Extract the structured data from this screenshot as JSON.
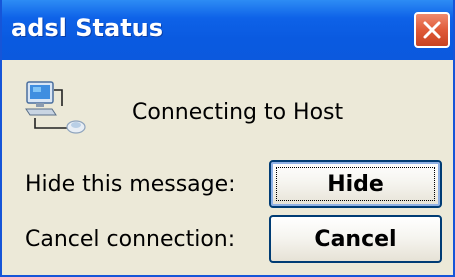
{
  "window": {
    "title": "adsl Status",
    "close_icon": "close-icon"
  },
  "status": {
    "icon": "network-connection-icon",
    "message": "Connecting to Host"
  },
  "actions": {
    "hide_label": "Hide this message:",
    "hide_button": "Hide",
    "cancel_label": "Cancel connection:",
    "cancel_button": "Cancel"
  },
  "colors": {
    "titlebar": "#0a5ae0",
    "close_button": "#e05a38",
    "dialog_background": "#ece9d8"
  }
}
